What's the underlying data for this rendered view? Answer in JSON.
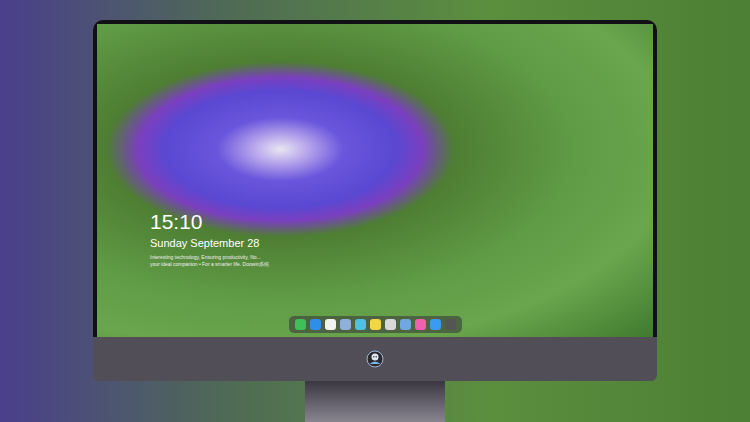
{
  "lock_screen": {
    "time": "15:10",
    "date": "Sunday September 28",
    "tagline": [
      "Interesting technology, Ensuring productivity, No...",
      "your ideal companion • For a smarter life. Doowin系统"
    ]
  }
}
